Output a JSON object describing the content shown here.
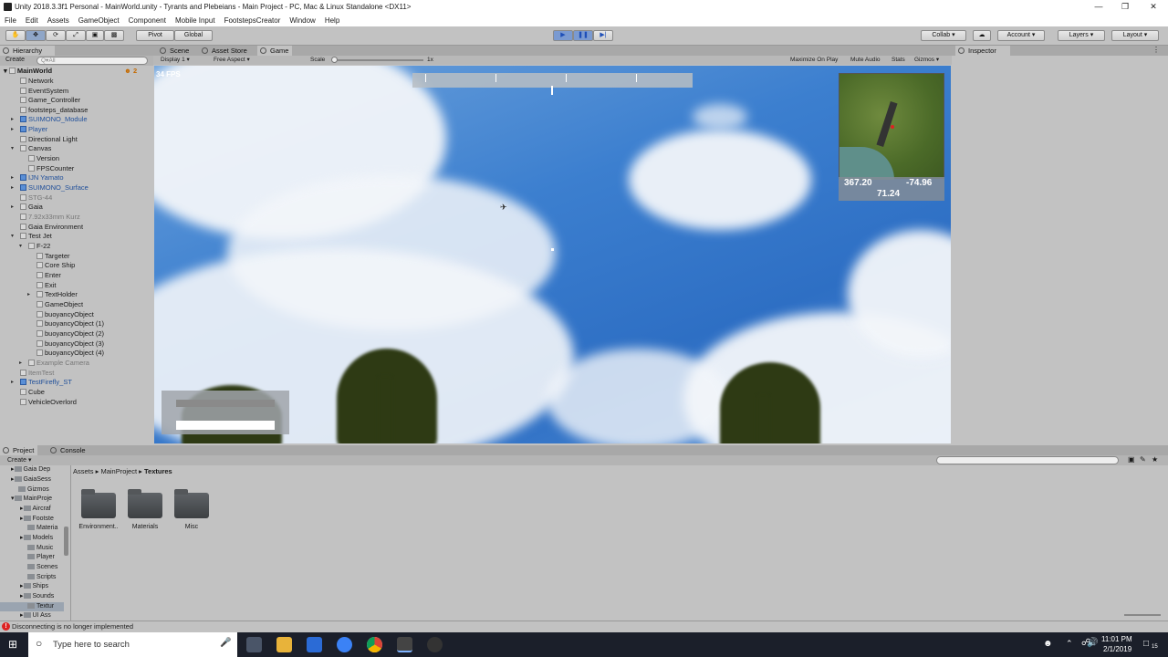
{
  "window": {
    "title": "Unity 2018.3.3f1 Personal - MainWorld.unity - Tyrants and Plebeians - Main Project - PC, Mac & Linux Standalone <DX11>"
  },
  "menu": [
    "File",
    "Edit",
    "Assets",
    "GameObject",
    "Component",
    "Mobile Input",
    "FootstepsCreator",
    "Window",
    "Help"
  ],
  "toolbar": {
    "pivot": "Pivot",
    "global": "Global",
    "collab": "Collab",
    "account": "Account",
    "layers": "Layers",
    "layout": "Layout"
  },
  "hierarchy": {
    "tab": "Hierarchy",
    "create": "Create",
    "search_placeholder": "Q▾All",
    "scene": "MainWorld",
    "scene_count": "2",
    "items": [
      {
        "label": "Network"
      },
      {
        "label": "EventSystem"
      },
      {
        "label": "Game_Controller"
      },
      {
        "label": "footsteps_database"
      },
      {
        "label": "SUIMONO_Module"
      },
      {
        "label": "Player"
      },
      {
        "label": "Directional Light"
      },
      {
        "label": "Canvas"
      },
      {
        "label": "Version"
      },
      {
        "label": "FPSCounter"
      },
      {
        "label": "IJN Yamato"
      },
      {
        "label": "SUIMONO_Surface"
      },
      {
        "label": "STG-44"
      },
      {
        "label": "Gaia"
      },
      {
        "label": "7.92x33mm Kurz"
      },
      {
        "label": "Gaia Environment"
      },
      {
        "label": "Test Jet"
      },
      {
        "label": "F-22"
      },
      {
        "label": "Targeter"
      },
      {
        "label": "Core Ship"
      },
      {
        "label": "Enter"
      },
      {
        "label": "Exit"
      },
      {
        "label": "TextHolder"
      },
      {
        "label": "GameObject"
      },
      {
        "label": "buoyancyObject"
      },
      {
        "label": "buoyancyObject (1)"
      },
      {
        "label": "buoyancyObject (2)"
      },
      {
        "label": "buoyancyObject (3)"
      },
      {
        "label": "buoyancyObject (4)"
      },
      {
        "label": "Example Camera"
      },
      {
        "label": "ItemTest"
      },
      {
        "label": "TestFirefly_ST"
      },
      {
        "label": "Cube"
      },
      {
        "label": "VehicleOverlord"
      }
    ]
  },
  "game": {
    "tabs": [
      "Scene",
      "Asset Store",
      "Game"
    ],
    "display": "Display 1",
    "aspect": "Free Aspect",
    "scale_label": "Scale",
    "scale_value": "1x",
    "options": [
      "Maximize On Play",
      "Mute Audio",
      "Stats",
      "Gizmos"
    ],
    "fps": "34 FPS",
    "minimap": {
      "x": "367.20",
      "z": "-74.96",
      "alt": "71.24"
    }
  },
  "inspector": {
    "tab": "Inspector"
  },
  "project": {
    "tabs": [
      "Project",
      "Console"
    ],
    "create": "Create",
    "breadcrumb": [
      "Assets",
      "MainProject",
      "Textures"
    ],
    "tree": [
      "Gaia Dep",
      "GaiaSess",
      "Gizmos",
      "MainProje",
      "Aircraf",
      "Footste",
      "Materia",
      "Models",
      "Music",
      "Player",
      "Scenes",
      "Scripts",
      "Ships",
      "Sounds",
      "Textur",
      "UI Ass"
    ],
    "folders": [
      "Environment..",
      "Materials",
      "Misc"
    ]
  },
  "status": {
    "message": "Disconnecting is no longer implemented"
  },
  "taskbar": {
    "search_placeholder": "Type here to search",
    "time": "11:01 PM",
    "date": "2/1/2019",
    "notif": "15"
  }
}
